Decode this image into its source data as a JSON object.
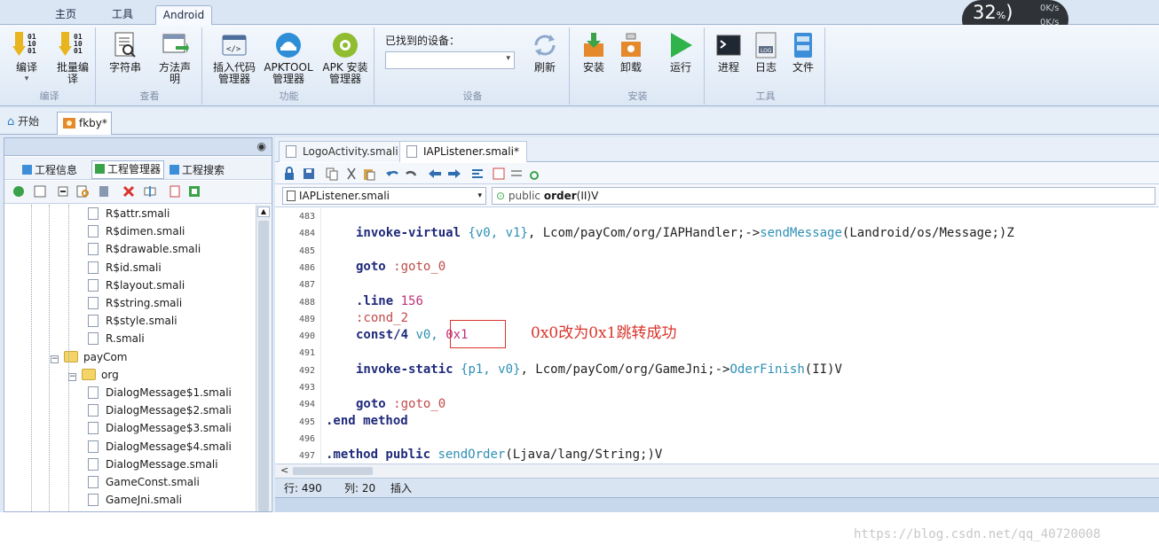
{
  "ribbon_tabs": [
    "主页",
    "工具",
    "Android"
  ],
  "active_tab": "Android",
  "groups": {
    "compile": {
      "label": "编译",
      "buttons": [
        {
          "label_l1": "编译",
          "label_l2": "",
          "icon": "binary-down-arrow-icon"
        },
        {
          "label_l1": "批量编",
          "label_l2": "译",
          "icon": "binary-batch-icon"
        }
      ]
    },
    "view": {
      "label": "查看",
      "buttons": [
        {
          "label_l1": "字符串",
          "label_l2": "",
          "icon": "document-search-icon"
        },
        {
          "label_l1": "方法声",
          "label_l2": "明",
          "icon": "method-declaration-icon"
        }
      ]
    },
    "function": {
      "label": "功能",
      "buttons": [
        {
          "label_l1": "插入代码",
          "label_l2": "管理器",
          "icon": "code-tag-icon"
        },
        {
          "label_l1": "APKTOOL",
          "label_l2": "管理器",
          "icon": "apktool-icon"
        },
        {
          "label_l1": "APK 安装",
          "label_l2": "管理器",
          "icon": "android-icon"
        }
      ]
    },
    "device": {
      "label": "设备",
      "found_label": "已找到的设备：",
      "select_value": "",
      "refresh_label": "刷新"
    },
    "install": {
      "label": "安装",
      "buttons": [
        {
          "label_l1": "安装",
          "icon": "install-icon"
        },
        {
          "label_l1": "卸载",
          "icon": "uninstall-icon"
        },
        {
          "label_l1": "运行",
          "icon": "run-play-icon"
        }
      ]
    },
    "tools": {
      "label": "工具",
      "buttons": [
        {
          "label_l1": "进程",
          "icon": "terminal-icon"
        },
        {
          "label_l1": "日志",
          "icon": "log-icon"
        },
        {
          "label_l1": "文件",
          "icon": "file-cabinet-icon"
        }
      ]
    }
  },
  "speed_widget": {
    "percent": "32",
    "unit": "%",
    "up": "0K/s",
    "down": "0K/s"
  },
  "doc_tabs": {
    "start": "开始",
    "project": "fkby*"
  },
  "left_panel": {
    "tabs": [
      "工程信息",
      "工程管理器",
      "工程搜索"
    ],
    "tree": [
      {
        "label": "R$attr.smali",
        "type": "file",
        "depth": 3
      },
      {
        "label": "R$dimen.smali",
        "type": "file",
        "depth": 3
      },
      {
        "label": "R$drawable.smali",
        "type": "file",
        "depth": 3
      },
      {
        "label": "R$id.smali",
        "type": "file",
        "depth": 3
      },
      {
        "label": "R$layout.smali",
        "type": "file",
        "depth": 3
      },
      {
        "label": "R$string.smali",
        "type": "file",
        "depth": 3
      },
      {
        "label": "R$style.smali",
        "type": "file",
        "depth": 3
      },
      {
        "label": "R.smali",
        "type": "file",
        "depth": 3
      },
      {
        "label": "payCom",
        "type": "folder",
        "depth": 1
      },
      {
        "label": "org",
        "type": "folder",
        "depth": 2
      },
      {
        "label": "DialogMessage$1.smali",
        "type": "file",
        "depth": 3
      },
      {
        "label": "DialogMessage$2.smali",
        "type": "file",
        "depth": 3
      },
      {
        "label": "DialogMessage$3.smali",
        "type": "file",
        "depth": 3
      },
      {
        "label": "DialogMessage$4.smali",
        "type": "file",
        "depth": 3
      },
      {
        "label": "DialogMessage.smali",
        "type": "file",
        "depth": 3
      },
      {
        "label": "GameConst.smali",
        "type": "file",
        "depth": 3
      },
      {
        "label": "GameJni.smali",
        "type": "file",
        "depth": 3
      }
    ]
  },
  "editor": {
    "tabs": [
      "LogoActivity.smali",
      "IAPListener.smali*"
    ],
    "active_tab": "IAPListener.smali*",
    "file_combo": "IAPListener.smali",
    "method_combo_prefix": "public",
    "method_combo_name": "order",
    "method_combo_sig": "(II)V",
    "line_numbers": [
      "483",
      "484",
      "485",
      "486",
      "487",
      "488",
      "489",
      "490",
      "491",
      "492",
      "493",
      "494",
      "495",
      "496",
      "497"
    ],
    "code": {
      "l484_kw": "invoke-virtual",
      "l484_args": "{v0, v1}",
      "l484_cls": ", Lcom/payCom/org/IAPHandler;->",
      "l484_meth": "sendMessage",
      "l484_sig": "(Landroid/os/Message;)Z",
      "l486_kw": "goto",
      "l486_lbl": ":goto_0",
      "l488_kw": ".line",
      "l488_num": "156",
      "l489_lbl": ":cond_2",
      "l490_kw": "const/4",
      "l490_reg": "v0,",
      "l490_val": "0x1",
      "l492_kw": "invoke-static",
      "l492_args": "{p1, v0}",
      "l492_cls": ", Lcom/payCom/org/GameJni;->",
      "l492_meth": "OderFinish",
      "l492_sig": "(II)V",
      "l494_kw": "goto",
      "l494_lbl": ":goto_0",
      "l495_kw": ".end method",
      "l497_kw": ".method public",
      "l497_meth": "sendOrder",
      "l497_sig": "(Ljava/lang/String;)V"
    },
    "annotation": "0x0改为0x1跳转成功",
    "status": {
      "row": "行: 490",
      "col": "列: 20",
      "mode": "插入"
    }
  },
  "watermark": "https://blog.csdn.net/qq_40720008",
  "colors": {
    "accent": "#1f2a7a",
    "highlight": "#d9342b",
    "panel_bg": "#dfe9f5"
  }
}
